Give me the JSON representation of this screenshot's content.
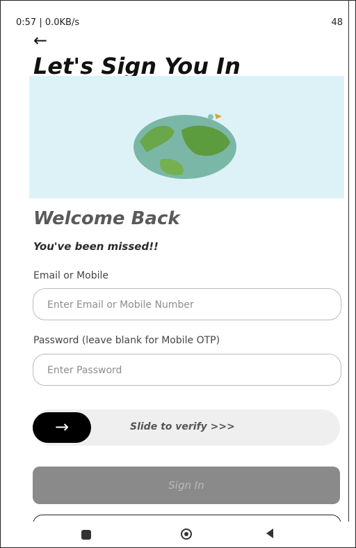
{
  "status_bar": {
    "left": "0:57 | 0.0KB/s",
    "right": "48"
  },
  "header": {
    "back_icon": "←",
    "title": "Let's Sign You In"
  },
  "hero": {
    "illustration": "globe-with-bird"
  },
  "welcome": {
    "title": "Welcome Back",
    "subtitle": "You've been missed!!"
  },
  "form": {
    "email_label": "Email or Mobile",
    "email_placeholder": "Enter Email or Mobile Number",
    "password_label": "Password (leave blank for Mobile OTP)",
    "password_placeholder": "Enter Password"
  },
  "verify": {
    "knob_icon": "→",
    "text": "Slide to verify >>>"
  },
  "actions": {
    "sign_in": "Sign In"
  },
  "nav": {
    "recent_icon": "square-icon",
    "home_icon": "circle-icon",
    "back_icon": "triangle-back-icon"
  },
  "colors": {
    "hero_bg": "#ddf2f6",
    "slider_bg": "#efefef",
    "signin_bg": "#8a8a8a",
    "knob_bg": "#000000"
  }
}
